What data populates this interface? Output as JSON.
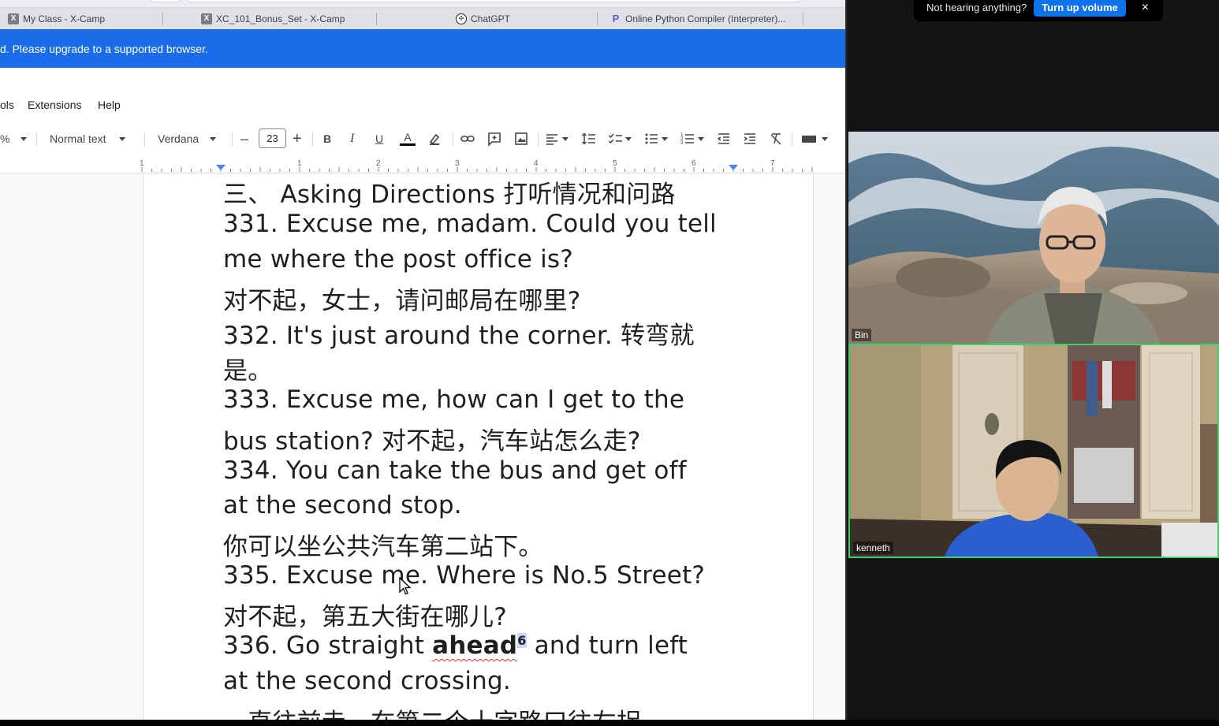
{
  "tabs": [
    {
      "label": "My Class - X-Camp",
      "icon": "xcamp-favicon"
    },
    {
      "label": "XC_101_Bonus_Set - X-Camp",
      "icon": "xcamp-favicon"
    },
    {
      "label": "ChatGPT",
      "icon": "chatgpt-favicon"
    },
    {
      "label": "Online Python Compiler (Interpreter)...",
      "icon": "programiz-favicon"
    }
  ],
  "banner": {
    "text": "d. Please upgrade to a supported browser."
  },
  "menu": {
    "items": [
      "ols",
      "Extensions",
      "Help"
    ]
  },
  "toolbar": {
    "zoom": "%",
    "style": "Normal text",
    "font": "Verdana",
    "minus": "–",
    "font_size": "23",
    "plus": "+",
    "bold": "B",
    "italic": "I",
    "underline": "U",
    "text_color": "A"
  },
  "ruler": {
    "numbers": [
      "1",
      "1",
      "2",
      "3",
      "4",
      "5",
      "6",
      "7"
    ]
  },
  "document": {
    "lines": [
      "三、 Asking Directions 打听情况和问路",
      "331. Excuse me, madam. Could you tell",
      "me where the post office is?",
      "对不起，女士，请问邮局在哪里?",
      "332. It's just around the corner. 转弯就",
      "是。",
      "333. Excuse me, how can I get to the",
      "bus station? 对不起，汽车站怎么走?",
      "334. You can take the bus and get off",
      "at the second stop.",
      "你可以坐公共汽车第二站下。",
      "335. Excuse me. Where is No.5 Street?",
      "对不起，第五大街在哪儿?",
      "",
      "at the second crossing.",
      "一直往前走，在第二个十字路口往左拐"
    ],
    "line336": {
      "prefix": "336. Go straight ",
      "bold_word": "ahead",
      "footnote": "6",
      "suffix": " and turn left"
    }
  },
  "zoom": {
    "toast_message": "Not hearing anything?",
    "toast_button": "Turn up volume",
    "toast_close": "×",
    "participants": [
      {
        "name": "Bin"
      },
      {
        "name": "kenneth"
      }
    ],
    "active_speaker_color": "#3fd06b"
  },
  "colors": {
    "banner": "#1a6ce8",
    "accent": "#0e72ed"
  }
}
